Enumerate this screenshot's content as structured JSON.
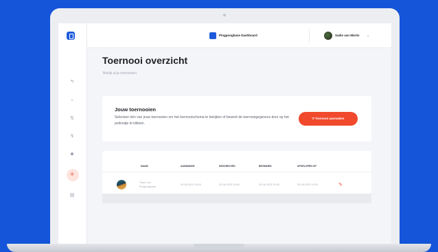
{
  "topbar": {
    "brand": "Pingpongbase Dashboard",
    "user_name": "Sadie van Mierlo",
    "chevron": "⌄"
  },
  "sidebar": {
    "items": [
      {
        "icon": "bell-icon",
        "glyph": "↰"
      },
      {
        "icon": "chevron-icon",
        "glyph": "⌄"
      },
      {
        "icon": "list-icon",
        "glyph": "⇅"
      },
      {
        "icon": "tag-icon",
        "glyph": "↯"
      },
      {
        "icon": "bookmark-icon",
        "glyph": "◆"
      },
      {
        "icon": "tournament-icon",
        "glyph": "✢"
      },
      {
        "icon": "archive-icon",
        "glyph": "▤"
      }
    ],
    "active_index": 5
  },
  "page": {
    "title": "Toernooi overzicht",
    "subtitle": "Bekijk al je toernooien."
  },
  "intro_card": {
    "title": "Jouw toernooien",
    "description": "Selecteer één van jouw toernooien om het toernooischema te bekijken of bewerk de toernooigegevens door op het potloodje te klikken.",
    "button_label": "▽  Toernooi aanmaken"
  },
  "table": {
    "headers": [
      "NAAM",
      "AANMAKEN",
      "INSCHRIJVEN",
      "BEGINNEN",
      "AFGELOPEN OP"
    ],
    "rows": [
      {
        "name": "Team Lea Pingpongbase",
        "created": "20-06-2023 18:00",
        "registration": "20-06-2023 18:00",
        "start": "20-06-2023 20:00",
        "ended": "20-06-2023 19:00"
      }
    ]
  },
  "colors": {
    "accent": "#f0492c",
    "brand": "#1e5bdc",
    "background": "#1455d9"
  }
}
